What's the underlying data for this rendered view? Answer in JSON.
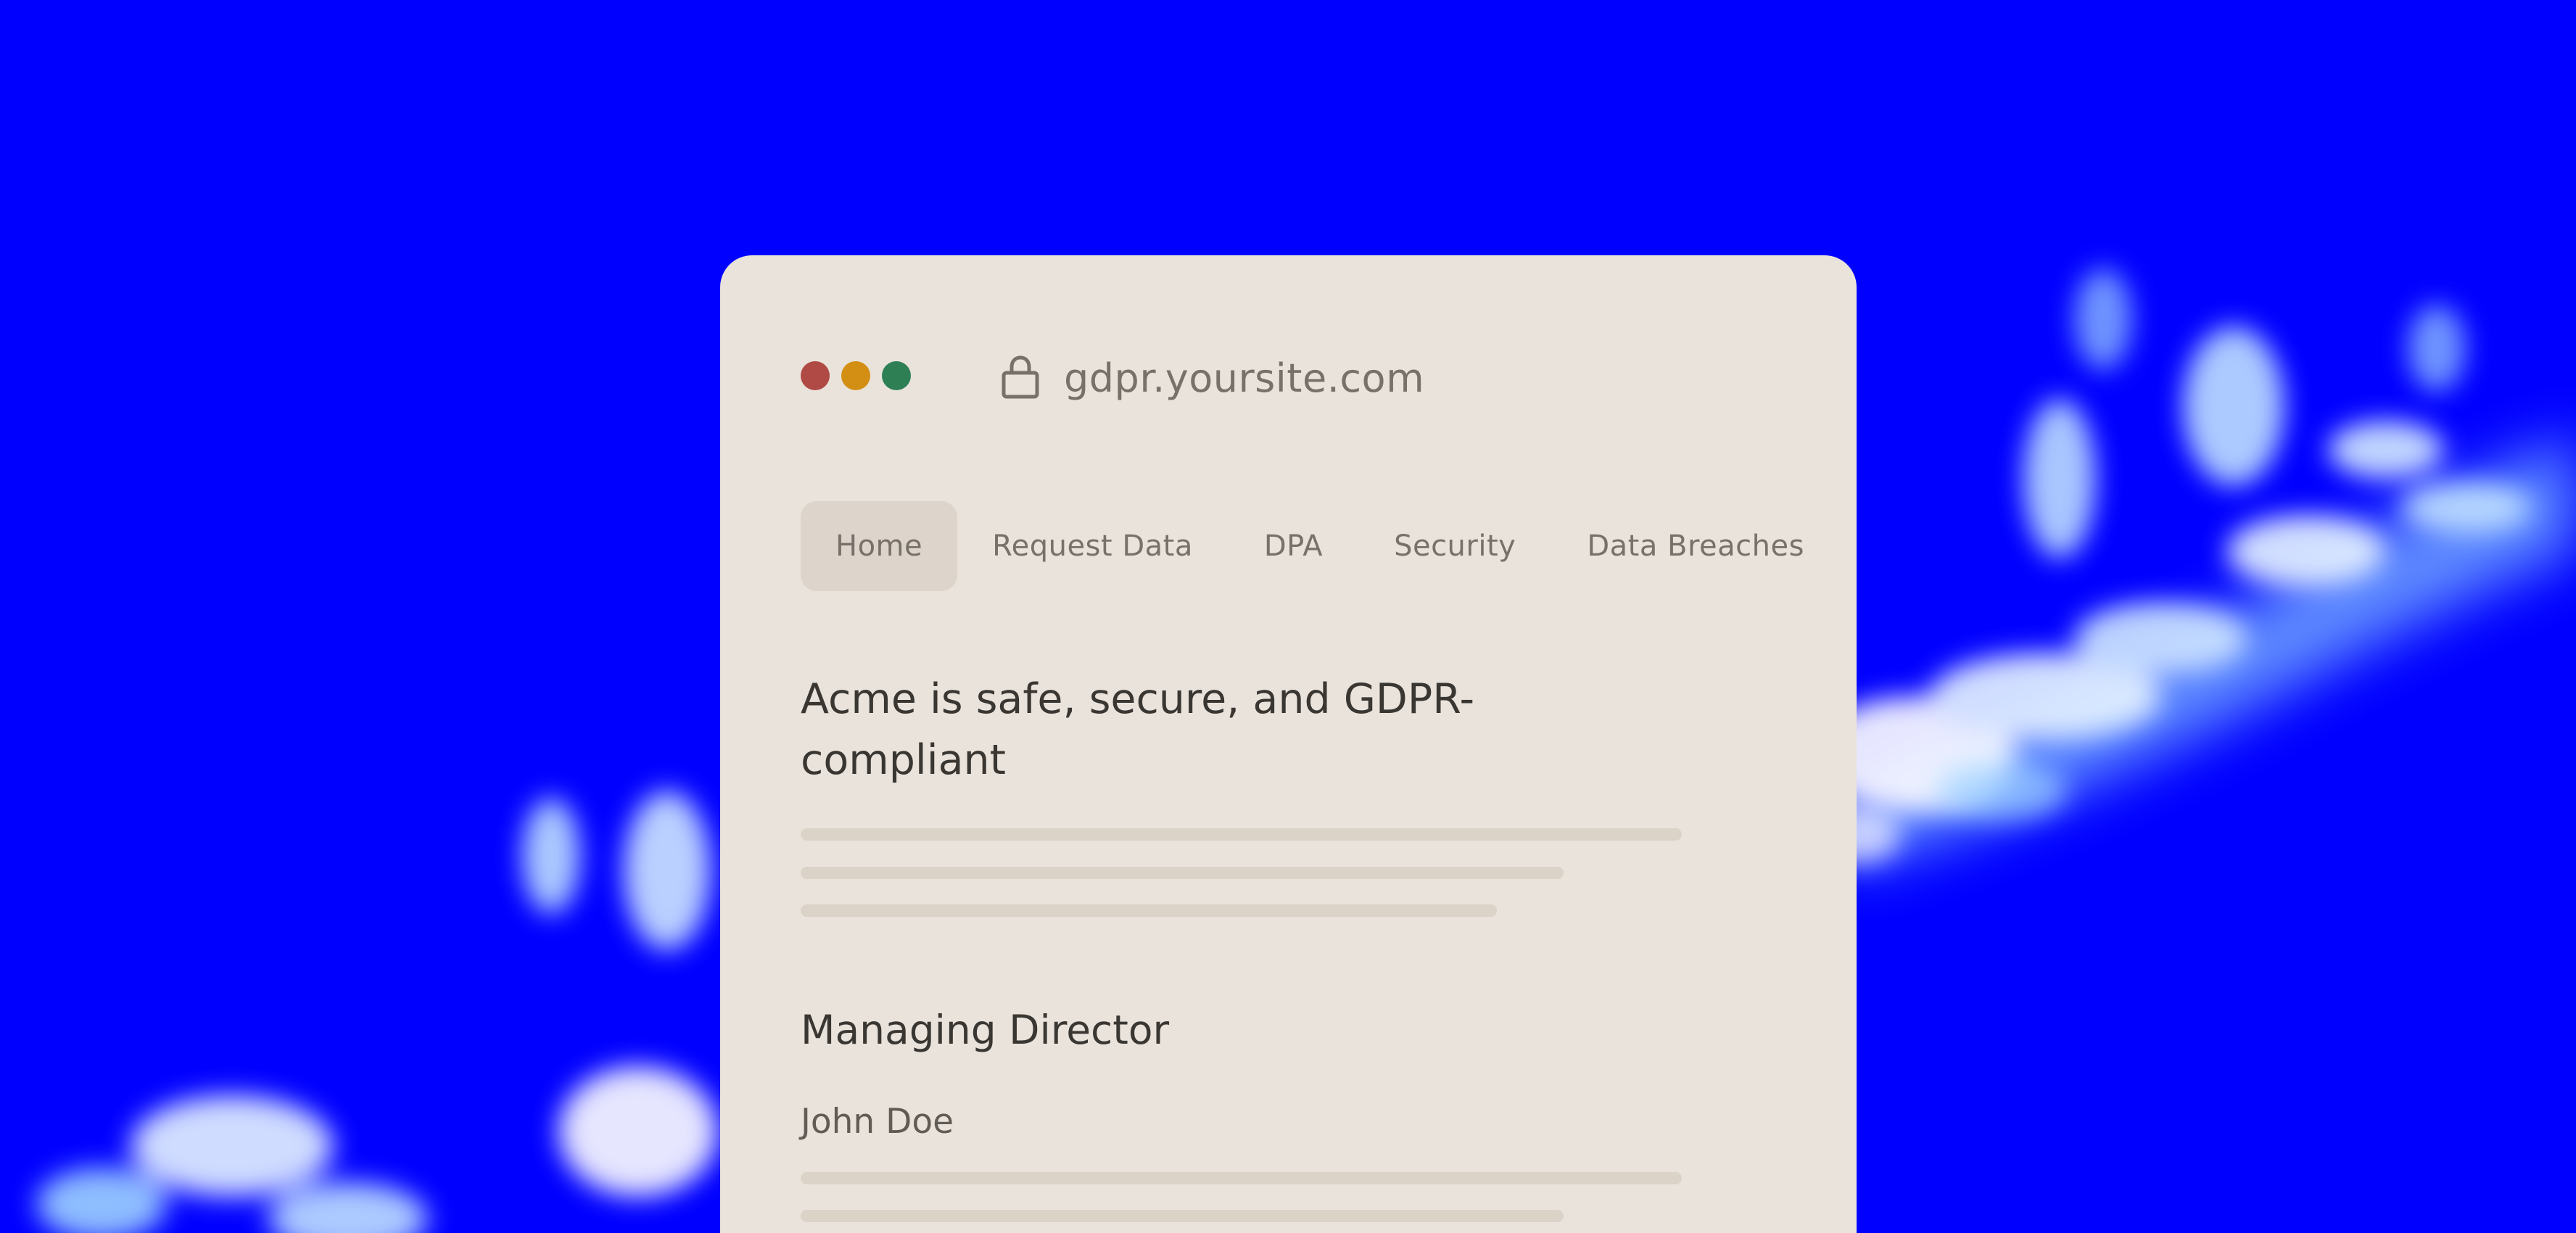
{
  "background_color": "#0000ff",
  "window": {
    "traffic_lights": {
      "close_color": "#b04a45",
      "minimize_color": "#d38f13",
      "maximize_color": "#2e8054"
    },
    "address_bar": {
      "icon": "lock-icon",
      "url": "gdpr.yoursite.com"
    },
    "nav": {
      "tabs": [
        {
          "label": "Home",
          "active": true
        },
        {
          "label": "Request Data",
          "active": false
        },
        {
          "label": "DPA",
          "active": false
        },
        {
          "label": "Security",
          "active": false
        },
        {
          "label": "Data Breaches",
          "active": false
        }
      ]
    },
    "content": {
      "heading": "Acme is safe, secure, and GDPR-compliant",
      "section_title": "Managing Director",
      "person_name": "John Doe"
    }
  }
}
